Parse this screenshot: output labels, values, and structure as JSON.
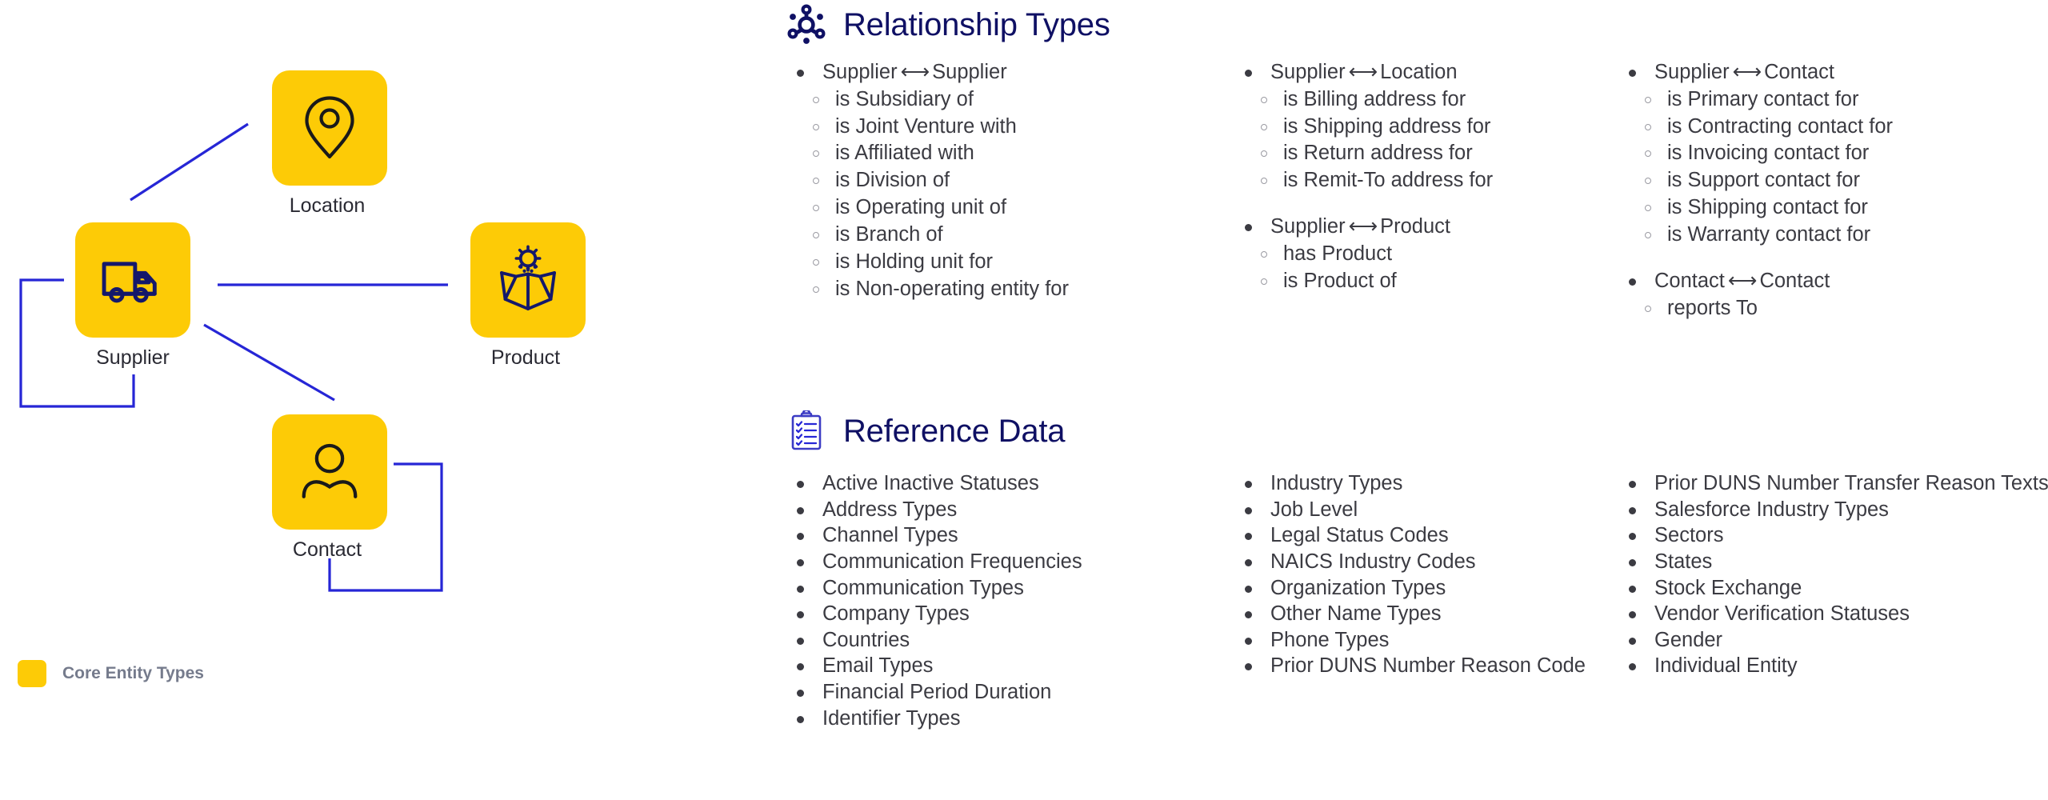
{
  "diagram": {
    "legend": {
      "label": "Core Entity Types",
      "swatch_color": "#FDCB06"
    },
    "node_color": "#FDCB06",
    "edge_color": "#2626d6",
    "nodes": [
      {
        "id": "supplier",
        "label": "Supplier",
        "icon": "truck-icon"
      },
      {
        "id": "location",
        "label": "Location",
        "icon": "map-pin-icon"
      },
      {
        "id": "product",
        "label": "Product",
        "icon": "open-box-gear-icon"
      },
      {
        "id": "contact",
        "label": "Contact",
        "icon": "person-icon"
      }
    ],
    "edges": [
      {
        "from": "supplier",
        "to": "location"
      },
      {
        "from": "supplier",
        "to": "product"
      },
      {
        "from": "supplier",
        "to": "contact"
      },
      {
        "from": "supplier",
        "to": "supplier"
      },
      {
        "from": "contact",
        "to": "contact"
      }
    ]
  },
  "relationship_types": {
    "title": "Relationship Types",
    "icon": "network-hub-icon",
    "title_color": "#0f1064",
    "columns": [
      {
        "groups": [
          {
            "left": "Supplier",
            "arrow": "⟷",
            "right": "Supplier",
            "items": [
              "is Subsidiary of",
              "is Joint Venture with",
              "is Affiliated with",
              "is Division of",
              "is Operating unit of",
              "is Branch of",
              "is Holding unit for",
              "is Non-operating entity for"
            ]
          }
        ]
      },
      {
        "groups": [
          {
            "left": "Supplier",
            "arrow": "⟷",
            "right": "Location",
            "items": [
              "is Billing address for",
              "is Shipping address for",
              "is Return address for",
              "is Remit-To address for"
            ]
          },
          {
            "left": "Supplier",
            "arrow": "⟷",
            "right": "Product",
            "items": [
              "has Product",
              "is Product of"
            ]
          }
        ]
      },
      {
        "groups": [
          {
            "left": "Supplier",
            "arrow": "⟷",
            "right": "Contact",
            "items": [
              "is Primary contact for",
              "is Contracting contact for",
              "is Invoicing contact for",
              "is Support contact for",
              "is Shipping contact for",
              "is Warranty contact for"
            ]
          },
          {
            "left": "Contact",
            "arrow": "⟷",
            "right": "Contact",
            "items": [
              "reports To"
            ]
          }
        ]
      }
    ]
  },
  "reference_data": {
    "title": "Reference Data",
    "icon": "clipboard-checklist-icon",
    "title_color": "#0f1064",
    "columns": [
      {
        "items": [
          "Active Inactive Statuses",
          "Address Types",
          "Channel Types",
          "Communication Frequencies",
          "Communication Types",
          "Company Types",
          "Countries",
          "Email Types",
          "Financial Period Duration",
          "Identifier Types"
        ]
      },
      {
        "items": [
          "Industry Types",
          "Job Level",
          "Legal Status Codes",
          "NAICS Industry Codes",
          "Organization Types",
          "Other Name Types",
          "Phone Types",
          "Prior DUNS Number Reason Code"
        ]
      },
      {
        "items": [
          "Prior DUNS Number Transfer Reason Texts",
          "Salesforce Industry Types",
          "Sectors",
          "States",
          "Stock Exchange",
          "Vendor Verification Statuses",
          "Gender",
          "Individual Entity"
        ]
      }
    ]
  }
}
